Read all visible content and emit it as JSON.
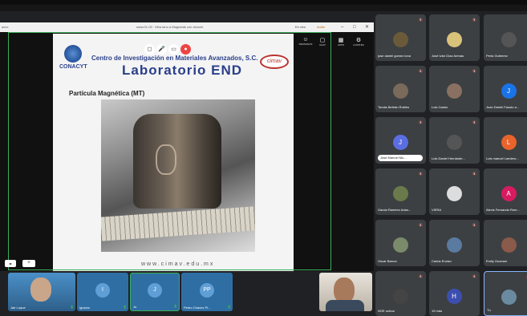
{
  "window": {
    "title_left": "avnc",
    "title_center": "www.01-00 · Mira lanu a Magnetak con cleaver",
    "recording": "En vivo",
    "audio": "Audio",
    "controls": [
      "–",
      "□",
      "✕"
    ]
  },
  "meeting_controls": [
    "◻",
    "🎤",
    "▭",
    "●"
  ],
  "right_tools": [
    {
      "icon": "person-icon",
      "glyph": "☺",
      "label": "PERSONAS"
    },
    {
      "icon": "chat-icon",
      "glyph": "▢",
      "label": "CHAT"
    },
    {
      "icon": "apps-icon",
      "glyph": "▦",
      "label": "APPS"
    },
    {
      "icon": "settings-icon",
      "glyph": "⚙",
      "label": "AJUSTES"
    }
  ],
  "slide": {
    "org": "CONACYT",
    "institution": "Centro de Investigación en Materiales Avanzados, S.C.",
    "cimav": "cimav",
    "lab_title": "Laboratorio END",
    "topic": "Partícula Magnética (MT)",
    "url": "www.cimav.edu.mx"
  },
  "zoom": {
    "left": "◂▸",
    "right": "+"
  },
  "bottom_thumbs": [
    {
      "name": "Jair Luque",
      "avatar": "",
      "bg": "#2f6ea3",
      "initial": ""
    },
    {
      "name": "Ignacio",
      "avatar": "I",
      "bg": "#2f6ea3",
      "initial": "I"
    },
    {
      "name": "Jo",
      "avatar": "J",
      "bg": "#2f6ea3",
      "initial": "J"
    },
    {
      "name": "Pedro Chavez Pi...",
      "avatar": "PP",
      "bg": "#2f6ea3",
      "initial": "PP"
    }
  ],
  "grid": [
    {
      "name": "jose daniel gomez luna",
      "initial": "",
      "color": "#6b5a3a"
    },
    {
      "name": "José Iván Díaz Arenas",
      "initial": "",
      "color": "#d9c27a"
    },
    {
      "name": "Perla Gutierrez",
      "initial": "",
      "color": "#555"
    },
    {
      "name": "Tomás Beltrán Robles",
      "initial": "",
      "color": "#7a6a5a"
    },
    {
      "name": "Luis Castro",
      "initial": "",
      "color": "#8a7060"
    },
    {
      "name": "Juan Daniel Fausto a...",
      "initial": "J",
      "color": "#1a73e8"
    },
    {
      "name": "José Manuel Mu...",
      "initial": "J",
      "color": "#5b6ee1",
      "chip": true
    },
    {
      "name": "Luis Daniel Hernánde...",
      "initial": "",
      "color": "#555"
    },
    {
      "name": "Luis manuel Landero...",
      "initial": "L",
      "color": "#e8642c"
    },
    {
      "name": "Garcia Ramirez Adan...",
      "initial": "",
      "color": "#6a7a4a"
    },
    {
      "name": "VIERA",
      "initial": "",
      "color": "#ddd"
    },
    {
      "name": "Alexis Fernando Rom...",
      "initial": "A",
      "color": "#d81b60"
    },
    {
      "name": "Oscar Barron",
      "initial": "",
      "color": "#7a8a6a"
    },
    {
      "name": "Carlos Enciso",
      "initial": "",
      "color": "#5a7aa0"
    },
    {
      "name": "Emily Guzman",
      "initial": "",
      "color": "#8a5a4a"
    },
    {
      "name": "NOE ochoa",
      "initial": "",
      "color": "#444"
    },
    {
      "name": "15 más",
      "initial": "H",
      "color": "#3c4fb0"
    },
    {
      "name": "Tú",
      "initial": "",
      "color": "#6a8aa0",
      "selected": true
    }
  ]
}
